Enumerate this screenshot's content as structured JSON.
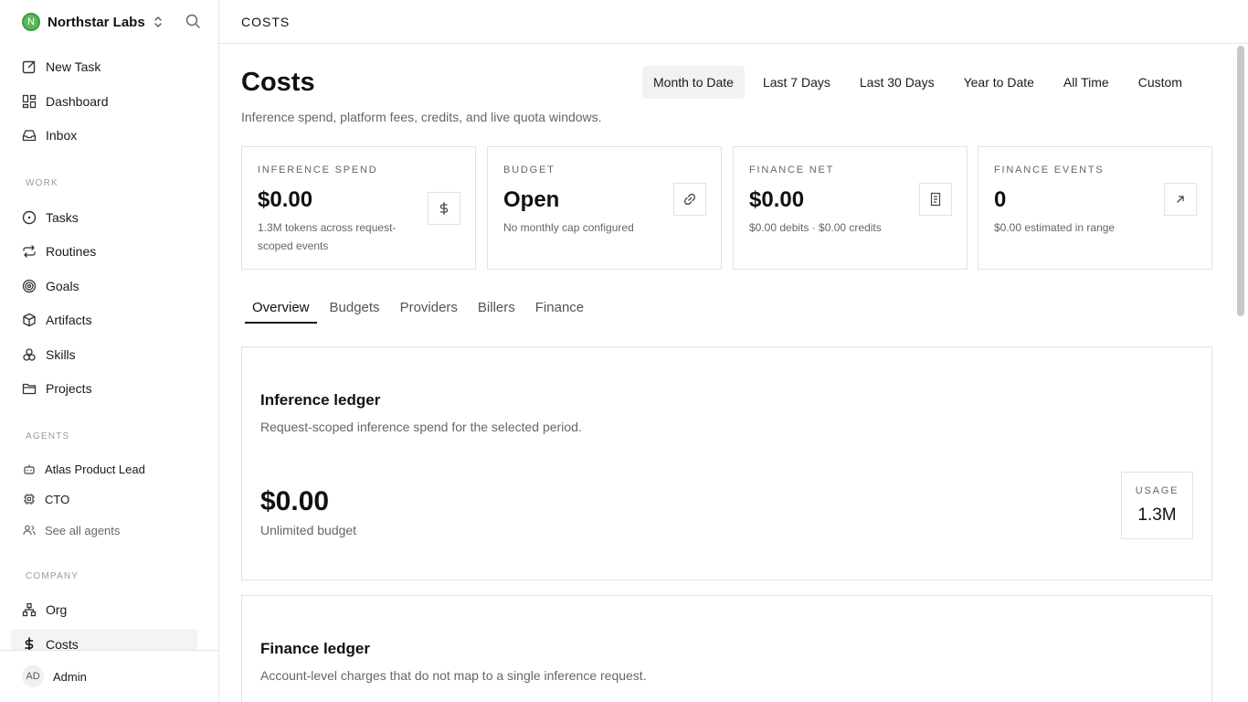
{
  "sidebar": {
    "company_name": "Northstar Labs",
    "logo_letter": "N",
    "top_items": [
      {
        "label": "New Task",
        "icon": "edit-icon"
      },
      {
        "label": "Dashboard",
        "icon": "dashboard-icon"
      },
      {
        "label": "Inbox",
        "icon": "inbox-icon"
      }
    ],
    "work_label": "WORK",
    "work_items": [
      {
        "label": "Tasks",
        "icon": "circle-icon"
      },
      {
        "label": "Routines",
        "icon": "repeat-icon"
      },
      {
        "label": "Goals",
        "icon": "target-icon"
      },
      {
        "label": "Artifacts",
        "icon": "box-icon"
      },
      {
        "label": "Skills",
        "icon": "boxes-icon"
      },
      {
        "label": "Projects",
        "icon": "folder-icon"
      }
    ],
    "agents_label": "AGENTS",
    "agents": [
      {
        "label": "Atlas Product Lead",
        "icon": "bot-icon"
      },
      {
        "label": "CTO",
        "icon": "cpu-icon"
      }
    ],
    "see_all_agents": "See all agents",
    "company_label": "COMPANY",
    "company_items": [
      {
        "label": "Org",
        "icon": "org-icon"
      },
      {
        "label": "Costs",
        "icon": "dollar-icon"
      }
    ],
    "user": {
      "initials": "AD",
      "name": "Admin"
    }
  },
  "topbar": {
    "breadcrumb": "COSTS"
  },
  "main": {
    "title": "Costs",
    "subtitle": "Inference spend, platform fees, credits, and live quota windows.",
    "range_tabs": [
      "Month to Date",
      "Last 7 Days",
      "Last 30 Days",
      "Year to Date",
      "All Time",
      "Custom"
    ],
    "active_range": "Month to Date",
    "cards": [
      {
        "label": "INFERENCE SPEND",
        "value": "$0.00",
        "sub": "1.3M tokens across request-scoped events",
        "icon": "dollar-icon"
      },
      {
        "label": "BUDGET",
        "value": "Open",
        "sub": "No monthly cap configured",
        "icon": "link-icon"
      },
      {
        "label": "FINANCE NET",
        "value": "$0.00",
        "sub": "$0.00 debits · $0.00 credits",
        "icon": "receipt-icon"
      },
      {
        "label": "FINANCE EVENTS",
        "value": "0",
        "sub": "$0.00 estimated in range",
        "icon": "arrow-up-right-icon"
      }
    ],
    "tabs": [
      "Overview",
      "Budgets",
      "Providers",
      "Billers",
      "Finance"
    ],
    "active_tab": "Overview",
    "inference_ledger": {
      "title": "Inference ledger",
      "subtitle": "Request-scoped inference spend for the selected period.",
      "amount": "$0.00",
      "amount_sub": "Unlimited budget",
      "usage_label": "USAGE",
      "usage_value": "1.3M"
    },
    "finance_ledger": {
      "title": "Finance ledger",
      "subtitle": "Account-level charges that do not map to a single inference request."
    }
  }
}
